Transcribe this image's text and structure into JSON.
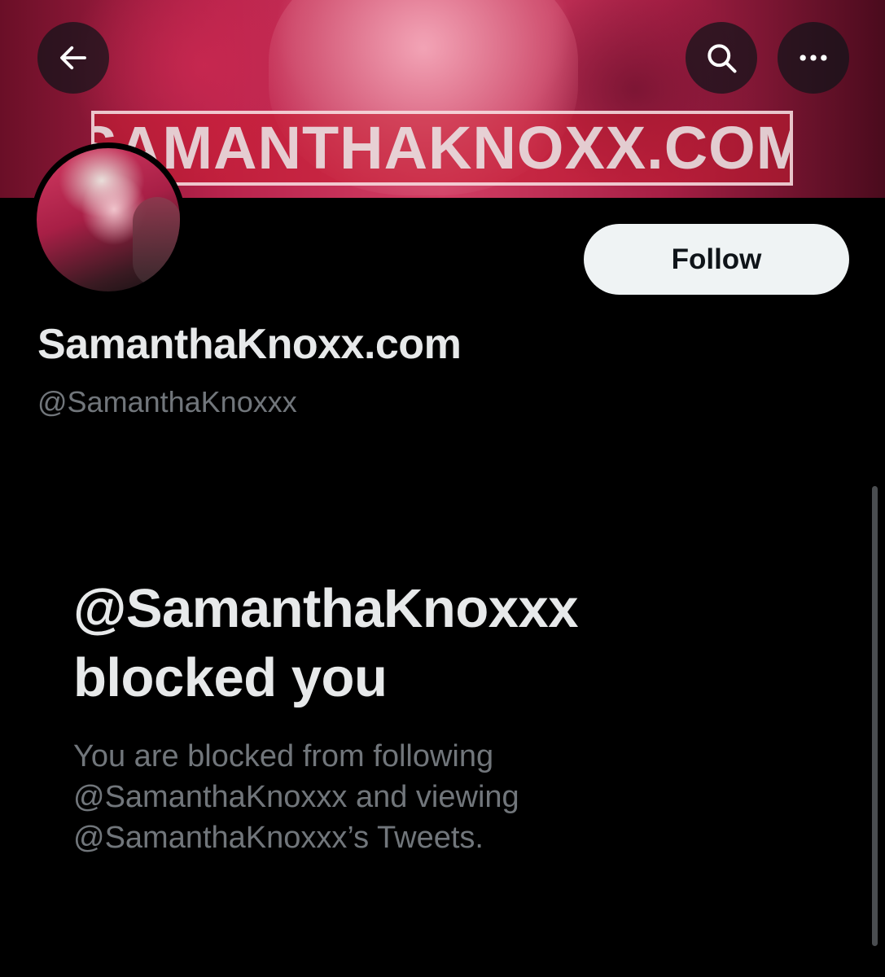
{
  "header": {
    "banner_watermark": "SAMANTHAKNOXX.COM",
    "back_icon": "arrow-left-icon",
    "search_icon": "search-icon",
    "more_icon": "more-horizontal-icon"
  },
  "profile": {
    "display_name": "SamanthaKnoxx.com",
    "handle": "@SamanthaKnoxxx",
    "follow_label": "Follow"
  },
  "blocked": {
    "title_line1": "@SamanthaKnoxxx",
    "title_line2": "blocked you",
    "desc_line1": "You are blocked from following",
    "desc_line2": "@SamanthaKnoxxx and viewing",
    "desc_line3": "@SamanthaKnoxxx’s Tweets."
  },
  "colors": {
    "background": "#000000",
    "primary_text": "#e7e9ea",
    "secondary_text": "#71767b",
    "button_bg": "#eff3f4",
    "button_text": "#0f1419"
  }
}
